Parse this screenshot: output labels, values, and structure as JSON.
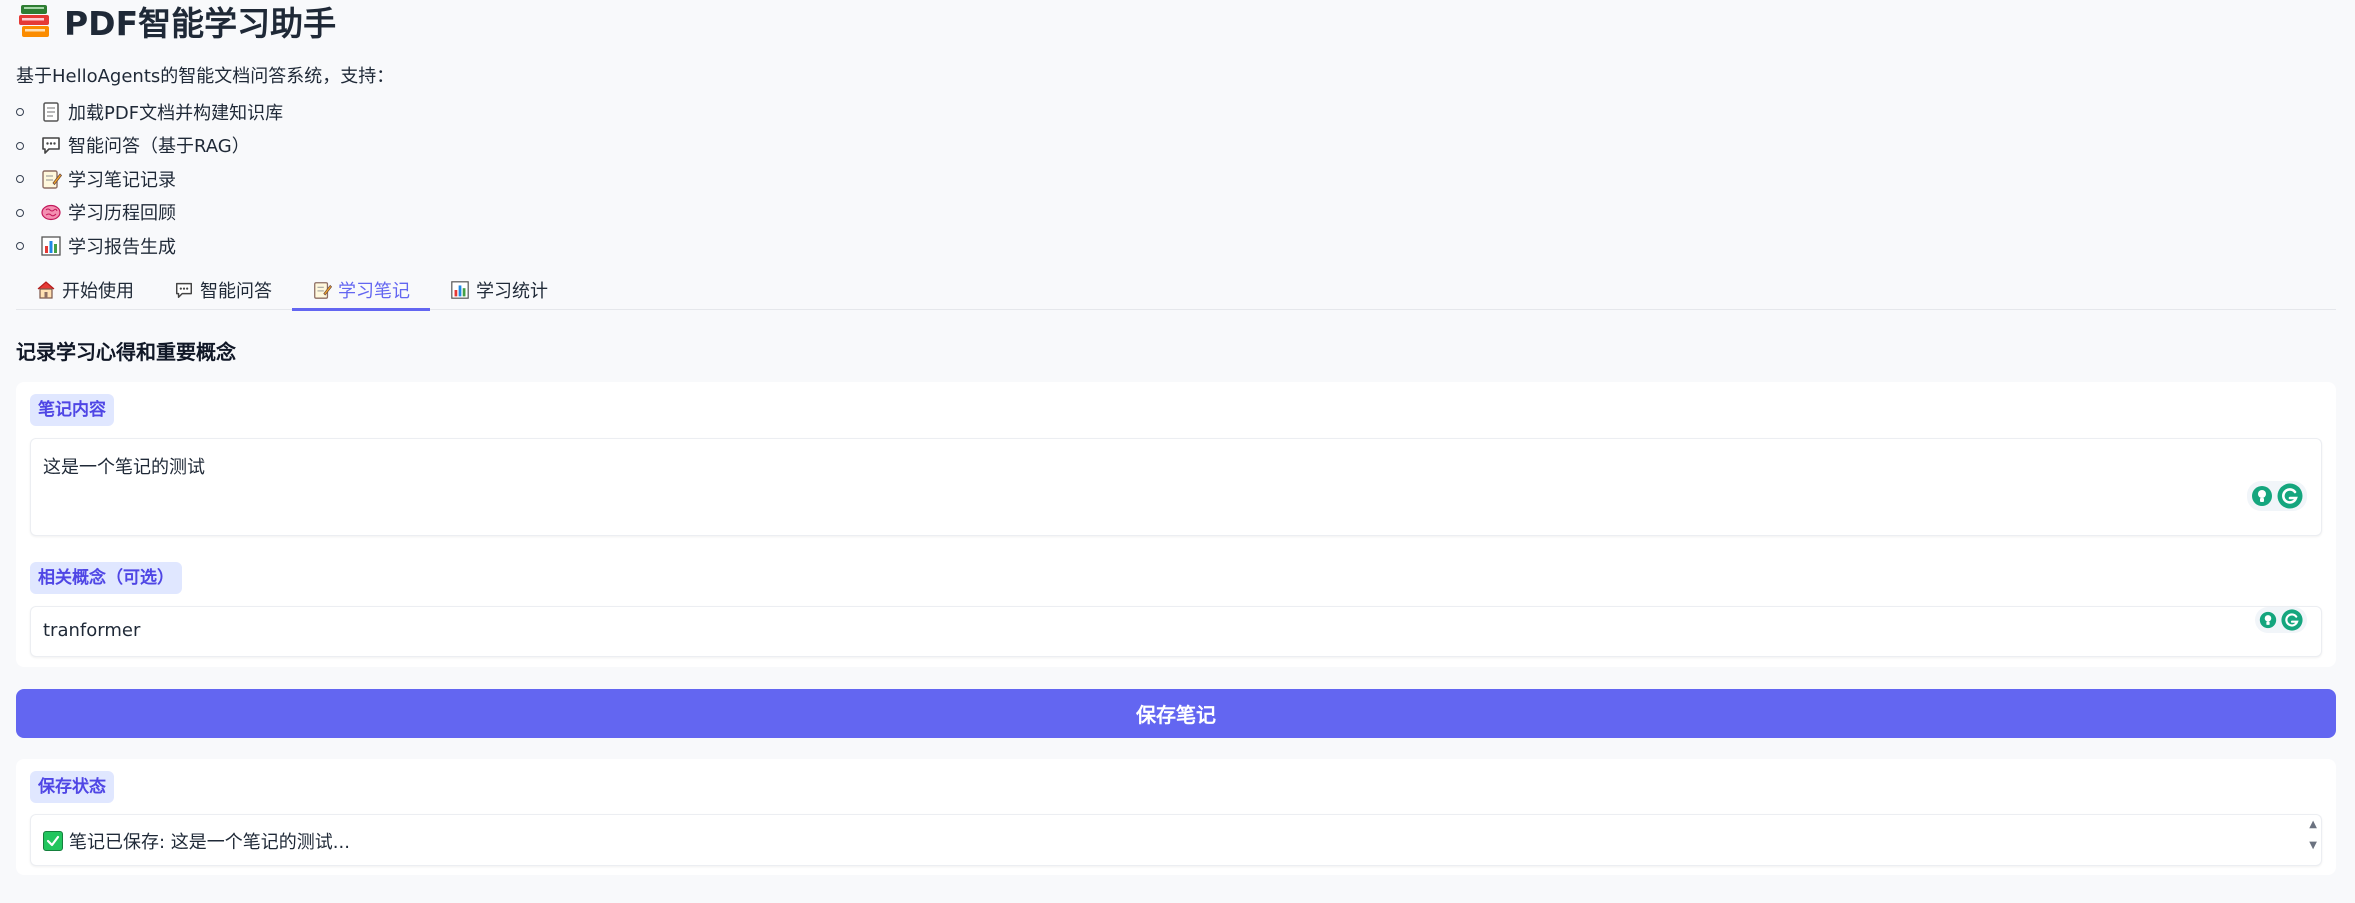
{
  "header": {
    "title": "PDF智能学习助手",
    "title_icon": "books-icon"
  },
  "intro": "基于HelloAgents的智能文档问答系统，支持：",
  "features": [
    {
      "icon": "document-icon",
      "label": "加载PDF文档并构建知识库"
    },
    {
      "icon": "speech-bubble-icon",
      "label": "智能问答（基于RAG）"
    },
    {
      "icon": "memo-icon",
      "label": "学习笔记记录"
    },
    {
      "icon": "brain-icon",
      "label": "学习历程回顾"
    },
    {
      "icon": "bar-chart-icon",
      "label": "学习报告生成"
    }
  ],
  "tabs": [
    {
      "icon": "house-icon",
      "label": "开始使用",
      "active": false
    },
    {
      "icon": "speech-bubble-icon",
      "label": "智能问答",
      "active": false
    },
    {
      "icon": "memo-icon",
      "label": "学习笔记",
      "active": true
    },
    {
      "icon": "bar-chart-icon",
      "label": "学习统计",
      "active": false
    }
  ],
  "notes": {
    "heading": "记录学习心得和重要概念",
    "content_label": "笔记内容",
    "content_value": "这是一个笔记的测试",
    "concept_label": "相关概念（可选）",
    "concept_value": "tranformer",
    "save_label": "保存笔记",
    "status_label": "保存状态",
    "status_value": "笔记已保存: 这是一个笔记的测试..."
  },
  "colors": {
    "accent": "#6366f1",
    "chip_bg": "#e0e7ff",
    "success": "#22c55e",
    "grammarly": "#15a67e"
  }
}
